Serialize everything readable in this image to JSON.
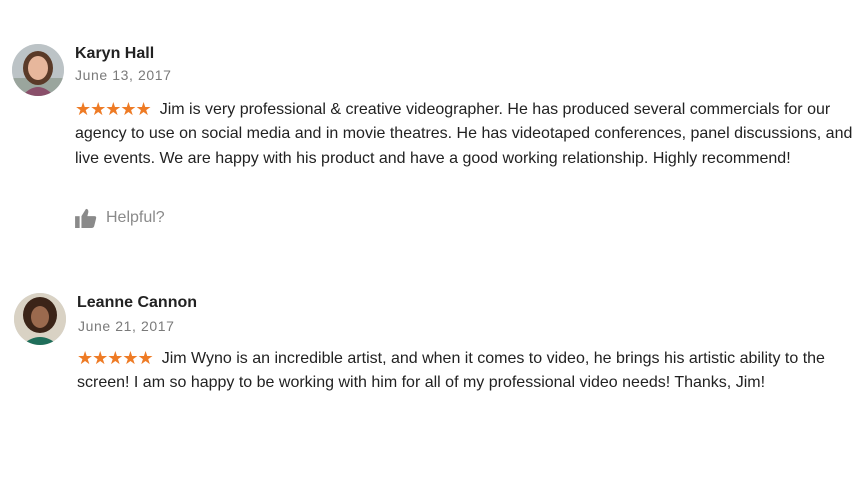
{
  "reviews": [
    {
      "reviewer": "Karyn Hall",
      "date": "June 13, 2017",
      "stars": "★★★★★",
      "text": "Jim is very professional & creative videographer. He has produced several commercials for our agency to use on social media and in movie theatres. He has videotaped conferences, panel discussions, and live events. We are happy with his product and have a good working relationship. Highly recommend!",
      "helpful_label": "Helpful?"
    },
    {
      "reviewer": "Leanne Cannon",
      "date": "June 21, 2017",
      "stars": "★★★★★",
      "text": "Jim Wyno is an incredible artist, and when it comes to video, he brings his artistic ability to the screen!  I am so happy to be working with him for all of my professional video needs!  Thanks, Jim!"
    }
  ],
  "colors": {
    "star": "#ee7b25",
    "meta": "#7a7a7a",
    "helpful": "#8a8a8a"
  }
}
